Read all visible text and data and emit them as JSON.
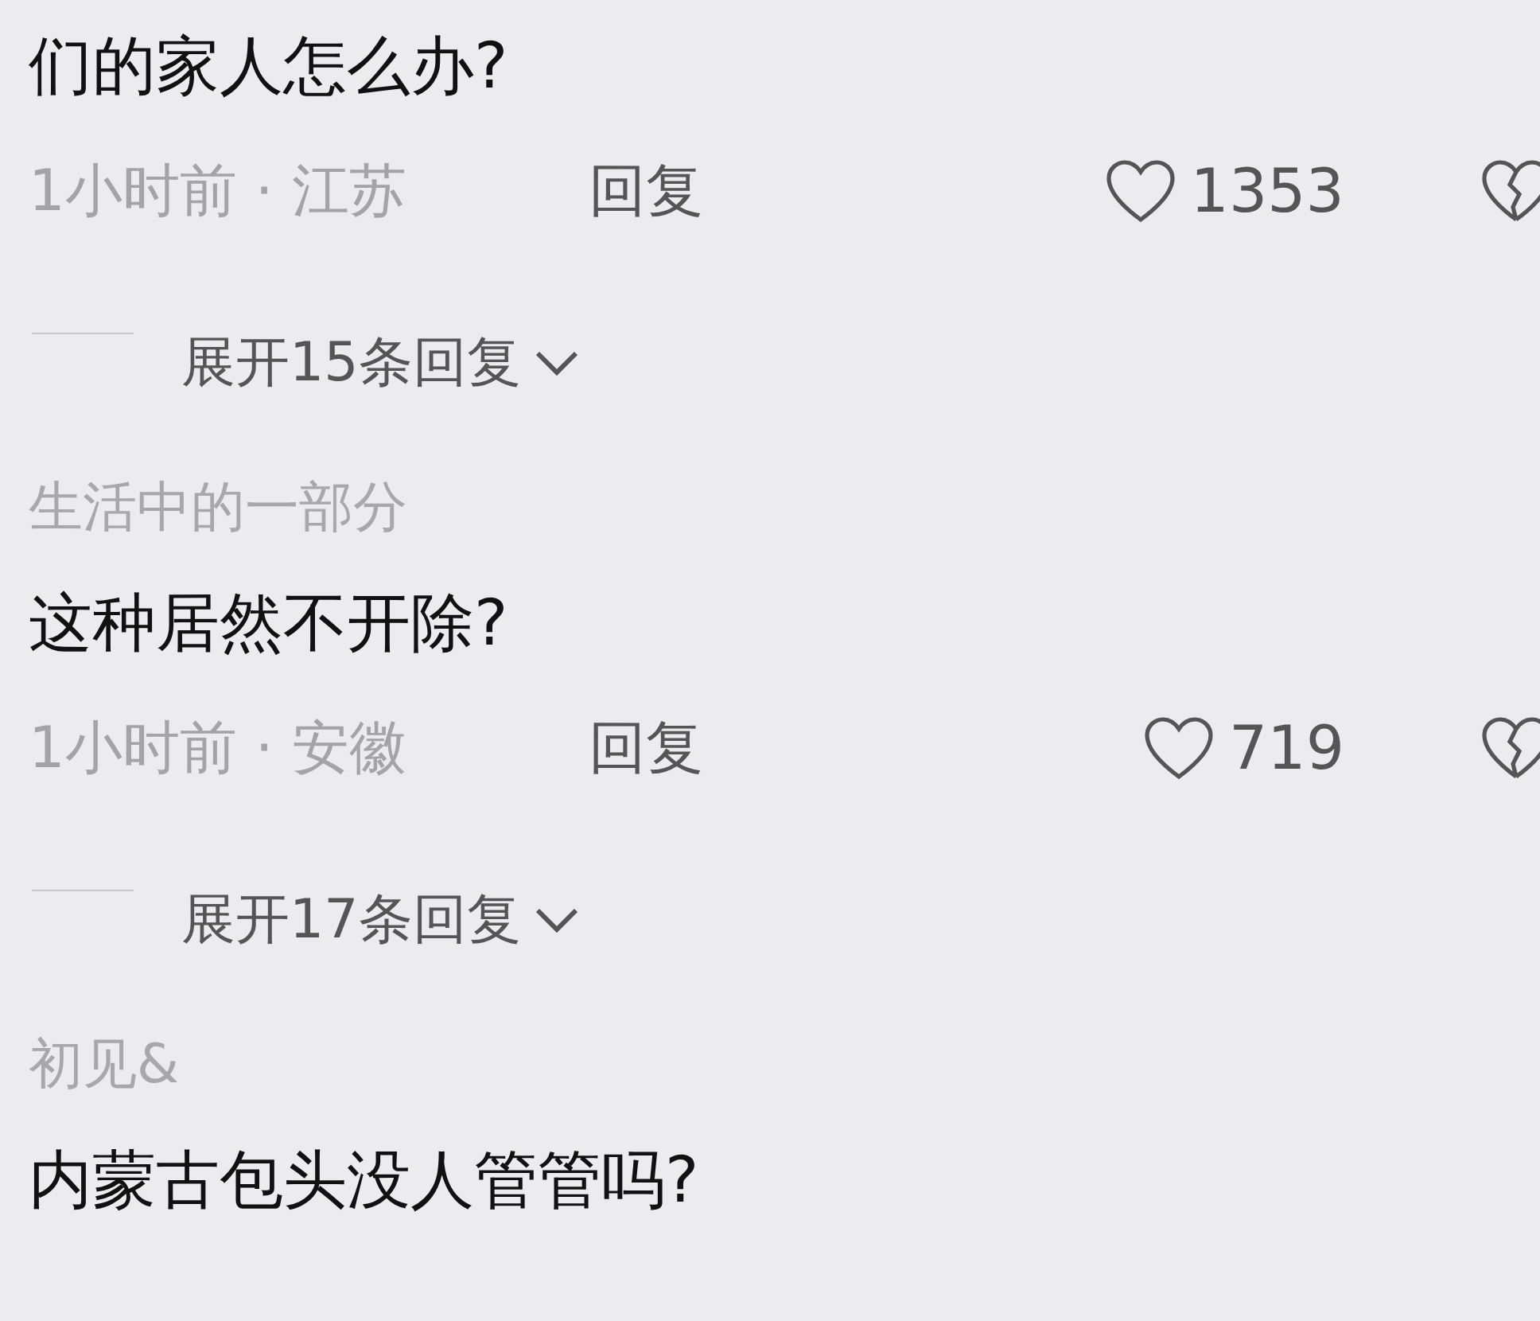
{
  "comments": [
    {
      "text": "们的家人怎么办?",
      "time": "1小时前",
      "separator": "·",
      "location": "江苏",
      "reply": "回复",
      "likes": "1353",
      "expand": "展开15条回复"
    },
    {
      "author": "生活中的一部分",
      "text": "这种居然不开除?",
      "time": "1小时前",
      "separator": "·",
      "location": "安徽",
      "reply": "回复",
      "likes": "719",
      "expand": "展开17条回复"
    },
    {
      "author": "初见&",
      "text": "内蒙古包头没人管管吗?"
    }
  ]
}
